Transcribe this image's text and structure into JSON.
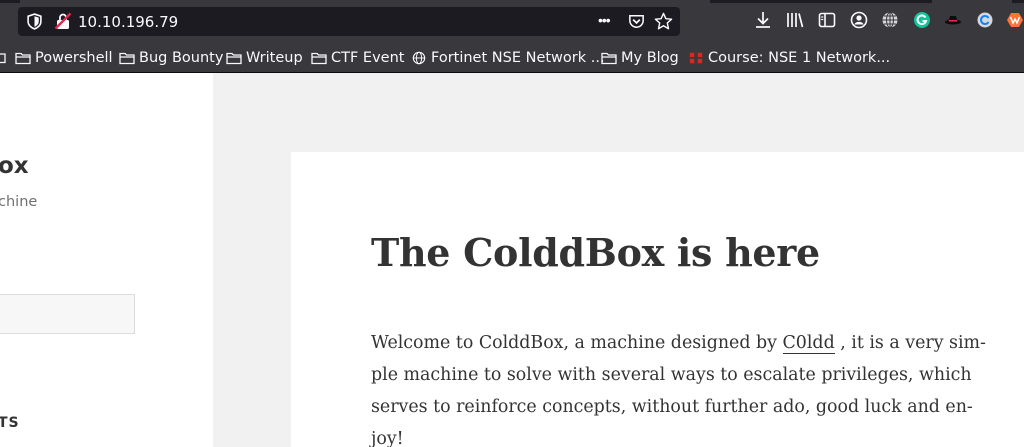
{
  "browser": {
    "url": "10.10.196.79",
    "page_actions_label": "•••"
  },
  "bookmarks": [
    {
      "label": "Powershell",
      "icon": "folder-icon"
    },
    {
      "label": "Bug Bounty",
      "icon": "folder-icon"
    },
    {
      "label": "Writeup",
      "icon": "folder-icon"
    },
    {
      "label": "CTF Event",
      "icon": "folder-icon"
    },
    {
      "label": "Fortinet NSE Network ...",
      "icon": "globe-icon"
    },
    {
      "label": "My Blog",
      "icon": "folder-icon"
    },
    {
      "label": "Course: NSE 1 Network...",
      "icon": "fortinet-icon"
    }
  ],
  "sidebar": {
    "site_title": "ox",
    "site_description": "chine",
    "widget_title": "TS"
  },
  "post": {
    "title": "The ColddBox is here",
    "content": {
      "line1_before": "Welcome to ColddBox, a machine designed by ",
      "author_link": "C0ldd",
      "line1_after": " , it is a very sim-",
      "line2": "ple machine to solve with several ways to escalate privileges, which",
      "line3": "serves to reinforce concepts, without further ado, good luck and en-",
      "line4": "joy!"
    }
  },
  "colors": {
    "toolbar": "#38383d",
    "urlbar": "#1c1b22",
    "page_background": "#f1f1f1",
    "text": "#333333"
  }
}
